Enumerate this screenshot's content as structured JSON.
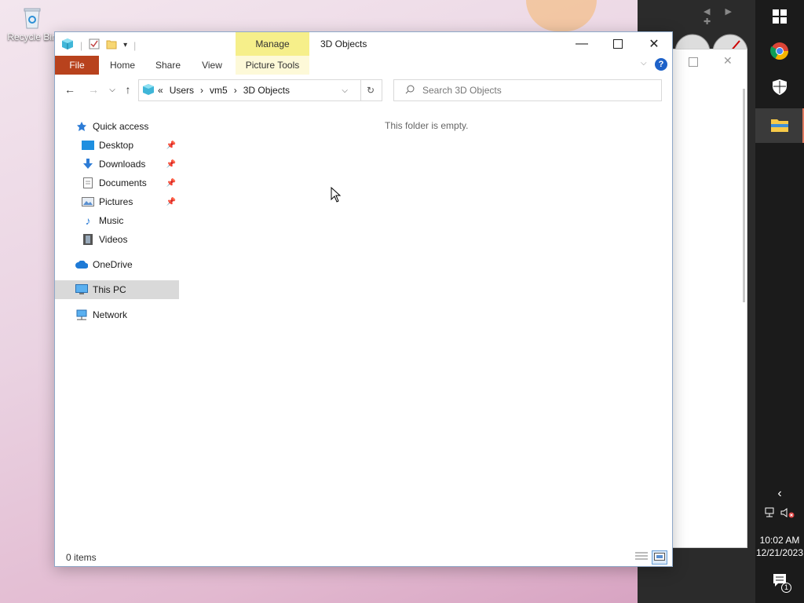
{
  "desktop": {
    "recycle_bin_label": "Recycle Bin"
  },
  "explorer": {
    "title": "3D Objects",
    "ribbon": {
      "file": "File",
      "home": "Home",
      "share": "Share",
      "view": "View",
      "manage": "Manage",
      "picture_tools": "Picture Tools"
    },
    "address": {
      "overflow": "«",
      "crumbs": [
        "Users",
        "vm5",
        "3D Objects"
      ],
      "separator": "›"
    },
    "search_placeholder": "Search 3D Objects",
    "sidebar": {
      "quick_access": "Quick access",
      "desktop": "Desktop",
      "downloads": "Downloads",
      "documents": "Documents",
      "pictures": "Pictures",
      "music": "Music",
      "videos": "Videos",
      "onedrive": "OneDrive",
      "this_pc": "This PC",
      "network": "Network"
    },
    "empty_message": "This folder is empty.",
    "status_count": "0 items"
  },
  "taskbar": {
    "time": "10:02 AM",
    "date": "12/21/2023",
    "notification_count": "1"
  },
  "colors": {
    "file_tab": "#b8421d",
    "manage_tab": "#f6ef8a",
    "selection": "#d9d9d9",
    "taskbar": "#1b1b1b"
  }
}
